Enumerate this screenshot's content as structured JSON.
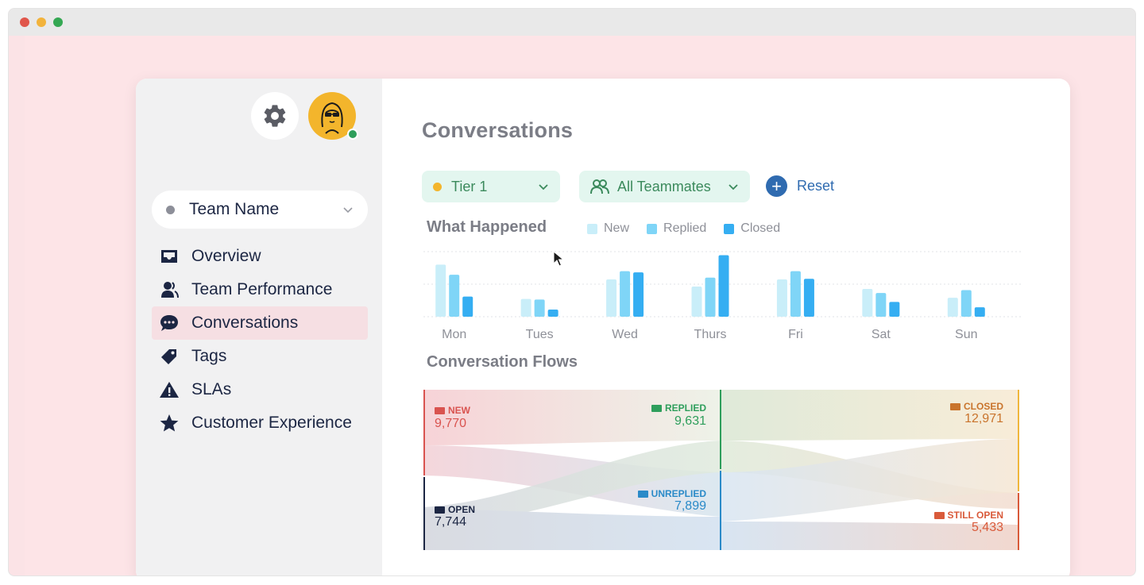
{
  "window": {
    "controls": {
      "close_color": "#e0564b",
      "minimize_color": "#f2b33c",
      "maximize_color": "#34a853"
    }
  },
  "sidebar": {
    "settings_icon": "gear-icon",
    "team_selector": {
      "label": "Team Name"
    },
    "nav": [
      {
        "label": "Overview",
        "icon": "inbox-icon",
        "active": false
      },
      {
        "label": "Team Performance",
        "icon": "users-icon",
        "active": false
      },
      {
        "label": "Conversations",
        "icon": "chat-bubble-icon",
        "active": true
      },
      {
        "label": "Tags",
        "icon": "tag-icon",
        "active": false
      },
      {
        "label": "SLAs",
        "icon": "warning-icon",
        "active": false
      },
      {
        "label": "Customer Experience",
        "icon": "star-icon",
        "active": false
      }
    ]
  },
  "main": {
    "title": "Conversations",
    "filters": {
      "tier": {
        "label": "Tier 1",
        "dot_color": "#f3b52c"
      },
      "teammates": {
        "label": "All Teammates"
      },
      "reset_label": "Reset"
    },
    "what_happened": {
      "title": "What Happened",
      "legend": [
        {
          "label": "New",
          "color": "#c9eef9"
        },
        {
          "label": "Replied",
          "color": "#7fd5f7"
        },
        {
          "label": "Closed",
          "color": "#35aef2"
        }
      ]
    },
    "flows": {
      "title": "Conversation Flows",
      "nodes": {
        "new": {
          "label": "NEW",
          "value": "9,770",
          "color": "#d9534f"
        },
        "open": {
          "label": "OPEN",
          "value": "7,744",
          "color": "#1c2643"
        },
        "replied": {
          "label": "REPLIED",
          "value": "9,631",
          "color": "#2e9e5b"
        },
        "unreplied": {
          "label": "UNREPLIED",
          "value": "7,899",
          "color": "#2a8ac8"
        },
        "closed": {
          "label": "CLOSED",
          "value": "12,971",
          "color": "#c9742c"
        },
        "still_open": {
          "label": "STILL OPEN",
          "value": "5,433",
          "color": "#d95a3a"
        }
      }
    }
  },
  "chart_data": {
    "type": "bar",
    "categories": [
      "Mon",
      "Tues",
      "Wed",
      "Thurs",
      "Fri",
      "Sat",
      "Sun"
    ],
    "series": [
      {
        "name": "New",
        "values": [
          88,
          30,
          63,
          51,
          63,
          47,
          32
        ]
      },
      {
        "name": "Replied",
        "values": [
          71,
          29,
          77,
          66,
          77,
          40,
          45
        ]
      },
      {
        "name": "Closed",
        "values": [
          34,
          12,
          75,
          104,
          64,
          25,
          16
        ]
      }
    ],
    "ylim": [
      0,
      110
    ],
    "grid": true,
    "legend": "top"
  }
}
